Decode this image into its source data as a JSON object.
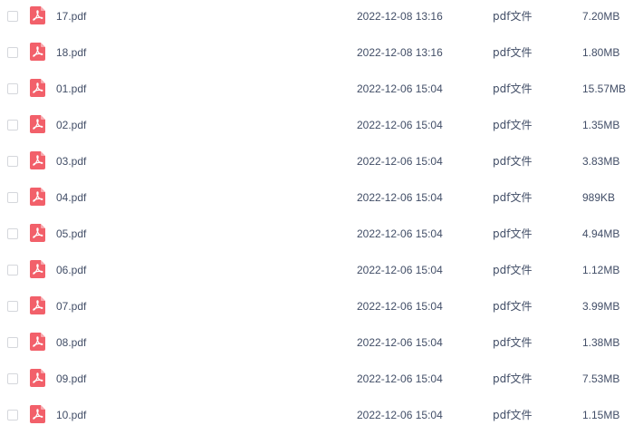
{
  "icon": "pdf-file-icon",
  "icon_color": "#f2606a",
  "files": [
    {
      "name": "17.pdf",
      "date": "2022-12-08 13:16",
      "type": "pdf文件",
      "size": "7.20MB"
    },
    {
      "name": "18.pdf",
      "date": "2022-12-08 13:16",
      "type": "pdf文件",
      "size": "1.80MB"
    },
    {
      "name": "01.pdf",
      "date": "2022-12-06 15:04",
      "type": "pdf文件",
      "size": "15.57MB"
    },
    {
      "name": "02.pdf",
      "date": "2022-12-06 15:04",
      "type": "pdf文件",
      "size": "1.35MB"
    },
    {
      "name": "03.pdf",
      "date": "2022-12-06 15:04",
      "type": "pdf文件",
      "size": "3.83MB"
    },
    {
      "name": "04.pdf",
      "date": "2022-12-06 15:04",
      "type": "pdf文件",
      "size": "989KB"
    },
    {
      "name": "05.pdf",
      "date": "2022-12-06 15:04",
      "type": "pdf文件",
      "size": "4.94MB"
    },
    {
      "name": "06.pdf",
      "date": "2022-12-06 15:04",
      "type": "pdf文件",
      "size": "1.12MB"
    },
    {
      "name": "07.pdf",
      "date": "2022-12-06 15:04",
      "type": "pdf文件",
      "size": "3.99MB"
    },
    {
      "name": "08.pdf",
      "date": "2022-12-06 15:04",
      "type": "pdf文件",
      "size": "1.38MB"
    },
    {
      "name": "09.pdf",
      "date": "2022-12-06 15:04",
      "type": "pdf文件",
      "size": "7.53MB"
    },
    {
      "name": "10.pdf",
      "date": "2022-12-06 15:04",
      "type": "pdf文件",
      "size": "1.15MB"
    }
  ]
}
